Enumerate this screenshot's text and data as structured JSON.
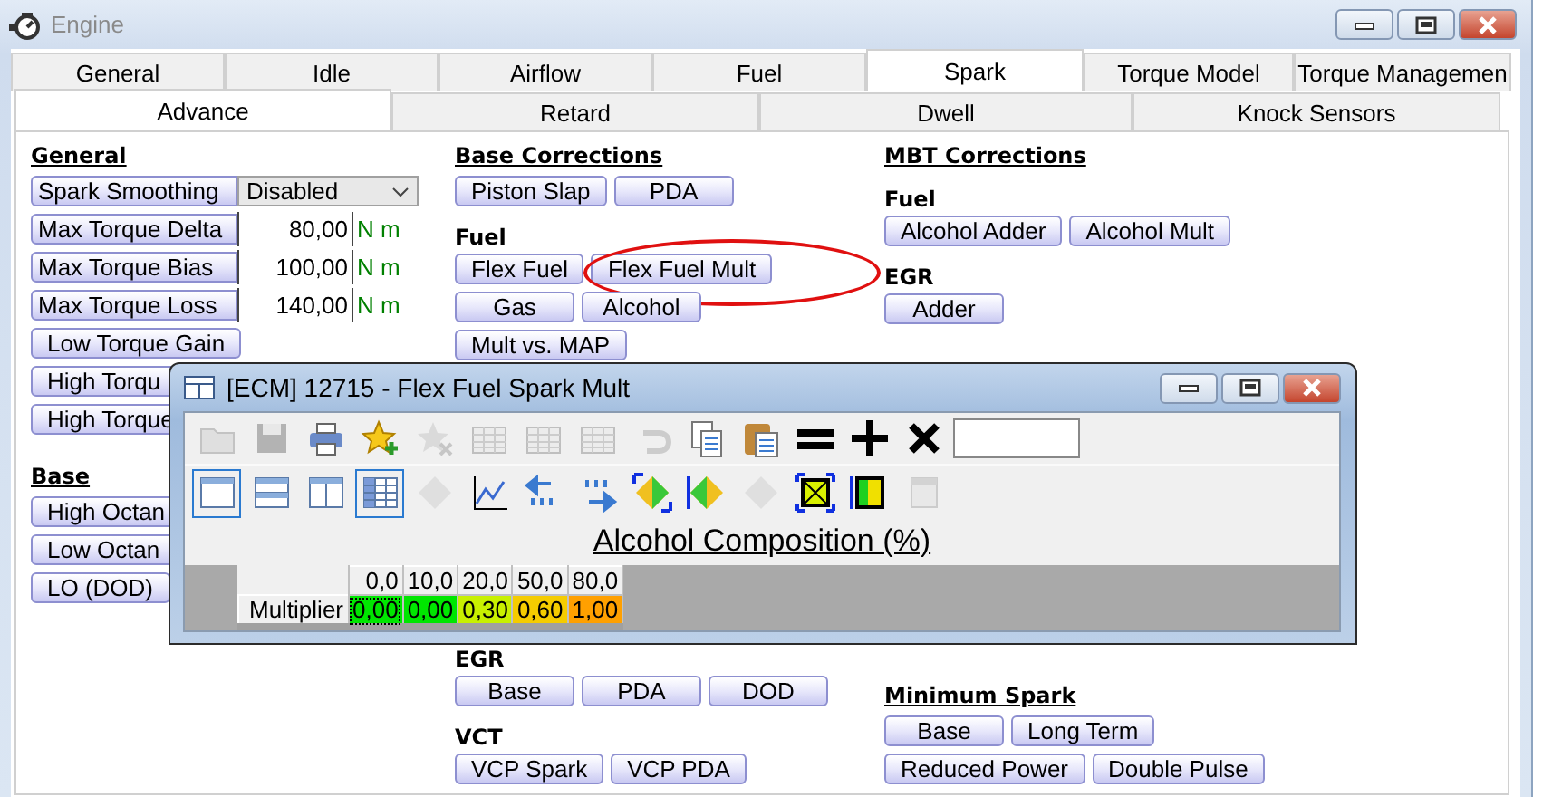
{
  "window": {
    "title": "Engine"
  },
  "tabs": [
    {
      "label": "General",
      "selected": false
    },
    {
      "label": "Idle",
      "selected": false
    },
    {
      "label": "Airflow",
      "selected": false
    },
    {
      "label": "Fuel",
      "selected": false
    },
    {
      "label": "Spark",
      "selected": true
    },
    {
      "label": "Torque Model",
      "selected": false
    },
    {
      "label": "Torque Managemen",
      "selected": false
    }
  ],
  "subtabs": [
    {
      "label": "Advance",
      "selected": true
    },
    {
      "label": "Retard",
      "selected": false
    },
    {
      "label": "Dwell",
      "selected": false
    },
    {
      "label": "Knock Sensors",
      "selected": false
    }
  ],
  "columns": [
    {
      "top": [
        {
          "kind": "heading",
          "text": "General"
        },
        {
          "kind": "select",
          "label": "Spark Smoothing",
          "value": "Disabled"
        },
        {
          "kind": "number",
          "label": "Max Torque Delta",
          "value": "80,00",
          "unit": "N m"
        },
        {
          "kind": "number",
          "label": "Max Torque Bias",
          "value": "100,00",
          "unit": "N m"
        },
        {
          "kind": "number",
          "label": "Max Torque Loss",
          "value": "140,00",
          "unit": "N m"
        },
        {
          "kind": "buttons",
          "items": [
            {
              "label": "Low Torque Gain",
              "circled": false
            }
          ]
        },
        {
          "kind": "buttons",
          "items": [
            {
              "label": "High Torqu",
              "circled": false
            }
          ]
        },
        {
          "kind": "buttons",
          "items": [
            {
              "label": "High Torque",
              "circled": false
            }
          ]
        },
        {
          "kind": "heading",
          "text": "Base"
        },
        {
          "kind": "buttons",
          "items": [
            {
              "label": "High Octan",
              "circled": false
            }
          ]
        },
        {
          "kind": "buttons",
          "items": [
            {
              "label": "Low Octan",
              "circled": false
            }
          ]
        },
        {
          "kind": "buttons",
          "items": [
            {
              "label": "LO (DOD)",
              "circled": false
            }
          ]
        }
      ]
    },
    {
      "top": [
        {
          "kind": "heading",
          "text": "Base Corrections"
        },
        {
          "kind": "buttons",
          "items": [
            {
              "label": "Piston Slap",
              "circled": false
            },
            {
              "label": "PDA",
              "circled": false
            }
          ]
        },
        {
          "kind": "subheading",
          "text": "Fuel"
        },
        {
          "kind": "buttons",
          "items": [
            {
              "label": "Flex Fuel",
              "circled": false
            },
            {
              "label": "Flex Fuel Mult",
              "circled": true
            }
          ]
        },
        {
          "kind": "buttons",
          "items": [
            {
              "label": "Gas",
              "circled": false
            },
            {
              "label": "Alcohol",
              "circled": false
            }
          ]
        },
        {
          "kind": "buttons",
          "items": [
            {
              "label": "Mult vs. MAP",
              "circled": false
            }
          ]
        }
      ],
      "bottom": [
        {
          "kind": "subheading",
          "text": "EGR"
        },
        {
          "kind": "buttons",
          "items": [
            {
              "label": "Base",
              "circled": false
            },
            {
              "label": "PDA",
              "circled": false
            },
            {
              "label": "DOD",
              "circled": false
            }
          ]
        },
        {
          "kind": "subheading",
          "text": "VCT"
        },
        {
          "kind": "buttons",
          "items": [
            {
              "label": "VCP Spark",
              "circled": false
            },
            {
              "label": "VCP PDA",
              "circled": false
            }
          ]
        }
      ]
    },
    {
      "top": [
        {
          "kind": "heading",
          "text": "MBT Corrections"
        },
        {
          "kind": "subheading",
          "text": "Fuel"
        },
        {
          "kind": "buttons",
          "items": [
            {
              "label": "Alcohol Adder",
              "circled": false
            },
            {
              "label": "Alcohol Mult",
              "circled": false
            }
          ]
        },
        {
          "kind": "subheading",
          "text": "EGR"
        },
        {
          "kind": "buttons",
          "items": [
            {
              "label": "Adder",
              "circled": false
            }
          ]
        }
      ],
      "bottom": [
        {
          "kind": "heading",
          "text": "Minimum Spark"
        },
        {
          "kind": "buttons",
          "items": [
            {
              "label": "Base",
              "circled": false
            },
            {
              "label": "Long Term",
              "circled": false
            }
          ]
        },
        {
          "kind": "buttons",
          "items": [
            {
              "label": "Reduced Power",
              "circled": false
            },
            {
              "label": "Double Pulse",
              "circled": false
            }
          ]
        }
      ]
    }
  ],
  "dialog": {
    "title": "[ECM] 12715 - Flex Fuel Spark Mult",
    "toolbar": [
      {
        "disabled": true
      },
      {
        "disabled": true
      },
      {
        "disabled": false
      },
      {
        "disabled": false
      },
      {
        "disabled": true
      },
      {
        "disabled": true
      },
      {
        "disabled": true
      },
      {
        "disabled": true
      },
      {
        "disabled": true
      },
      {
        "disabled": false
      },
      {
        "disabled": false
      },
      {
        "disabled": false
      },
      {
        "disabled": false
      },
      {
        "disabled": false
      }
    ],
    "view_toolbar": [
      {
        "selected": true,
        "disabled": false
      },
      {
        "selected": false,
        "disabled": false
      },
      {
        "selected": false,
        "disabled": false
      },
      {
        "selected": true,
        "disabled": false
      },
      {
        "selected": false,
        "disabled": true
      },
      {
        "selected": false,
        "disabled": false
      },
      {
        "selected": false,
        "disabled": false
      },
      {
        "selected": false,
        "disabled": false
      },
      {
        "selected": false,
        "disabled": false
      },
      {
        "selected": false,
        "disabled": false
      },
      {
        "selected": false,
        "disabled": true
      },
      {
        "selected": false,
        "disabled": false
      },
      {
        "selected": false,
        "disabled": false
      },
      {
        "selected": false,
        "disabled": true
      }
    ],
    "table": {
      "axis_title": "Alcohol Composition (%)",
      "columns": [
        "0,0",
        "10,0",
        "20,0",
        "50,0",
        "80,0"
      ],
      "rows": [
        {
          "label": "Multiplier",
          "cells": [
            {
              "value": "0,00",
              "color": "#00e600",
              "selected": true
            },
            {
              "value": "0,00",
              "color": "#00e600",
              "selected": false
            },
            {
              "value": "0,30",
              "color": "#c8f000",
              "selected": false
            },
            {
              "value": "0,60",
              "color": "#f5cc00",
              "selected": false
            },
            {
              "value": "1,00",
              "color": "#ffa000",
              "selected": false
            }
          ]
        }
      ]
    }
  }
}
